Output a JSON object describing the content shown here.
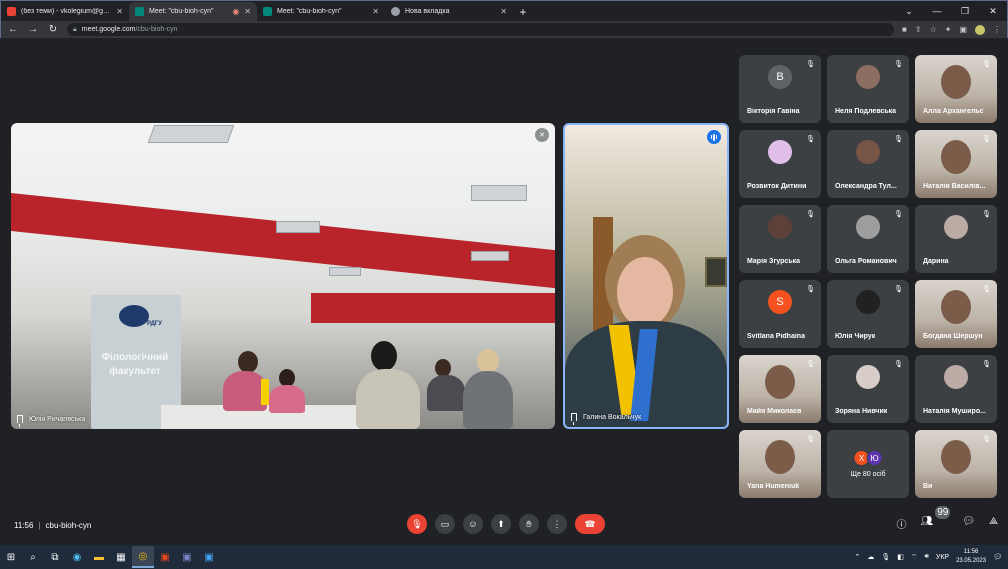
{
  "browser": {
    "tabs": [
      {
        "title": "(без теми) - vkolegium@gmail.c",
        "favicon_color": "#ea4335"
      },
      {
        "title": "Meet: \"cbu-bioh-cyn\"",
        "favicon_color": "#00897b"
      },
      {
        "title": "Meet: \"cbu-bioh-cyn\"",
        "favicon_color": "#00897b"
      },
      {
        "title": "Нова вкладка",
        "favicon_color": "#9aa0a6"
      }
    ],
    "new_tab": "+",
    "address": {
      "domain": "meet.google.com",
      "path": "/cbu-bioh-cyn"
    }
  },
  "main_tiles": [
    {
      "name": "Юлія Ричагівська",
      "banner": "Філологічний факультет",
      "logo": "РДГУ"
    },
    {
      "name": "Галина Вокальчук"
    }
  ],
  "grid": [
    {
      "name": "Вікторія Гавіна",
      "initial": "В",
      "color": "#5f6368"
    },
    {
      "name": "Неля Подлевська",
      "initial": "",
      "color": "#8d6e63"
    },
    {
      "name": "Алла Архангельс",
      "video": true
    },
    {
      "name": "Розвиток Дитини",
      "initial": "",
      "color": "#e1bee7"
    },
    {
      "name": "Олександра Тул...",
      "initial": "",
      "color": "#795548"
    },
    {
      "name": "Наталія Василів...",
      "video": true
    },
    {
      "name": "Марія Згурська",
      "initial": "",
      "color": "#5d4037"
    },
    {
      "name": "Ольга Романович",
      "initial": "",
      "color": "#9e9e9e"
    },
    {
      "name": "Дарина",
      "initial": "",
      "color": "#bcaaa4"
    },
    {
      "name": "Svitlana Pidhaina",
      "initial": "S",
      "color": "#f4511e"
    },
    {
      "name": "Юлія Чирук",
      "initial": "",
      "color": "#212121"
    },
    {
      "name": "Богдана Шершун",
      "video": true
    },
    {
      "name": "Майя Миколаєв",
      "video": true
    },
    {
      "name": "Зоряна Нивчик",
      "initial": "",
      "color": "#d7ccc8"
    },
    {
      "name": "Наталія Муширо...",
      "initial": "",
      "color": "#bcaaa4"
    },
    {
      "name": "Yana Humeniuk",
      "video": true
    },
    {
      "name": "Ще 80 осіб",
      "more": true,
      "a": "Х",
      "b": "Ю"
    },
    {
      "name": "Ви",
      "video": true
    }
  ],
  "meeting": {
    "time": "11:56",
    "code": "cbu-bioh-cyn",
    "people_badge": "99"
  },
  "taskbar": {
    "lang": "УКР",
    "time": "11:56",
    "date": "23.05.2023"
  }
}
